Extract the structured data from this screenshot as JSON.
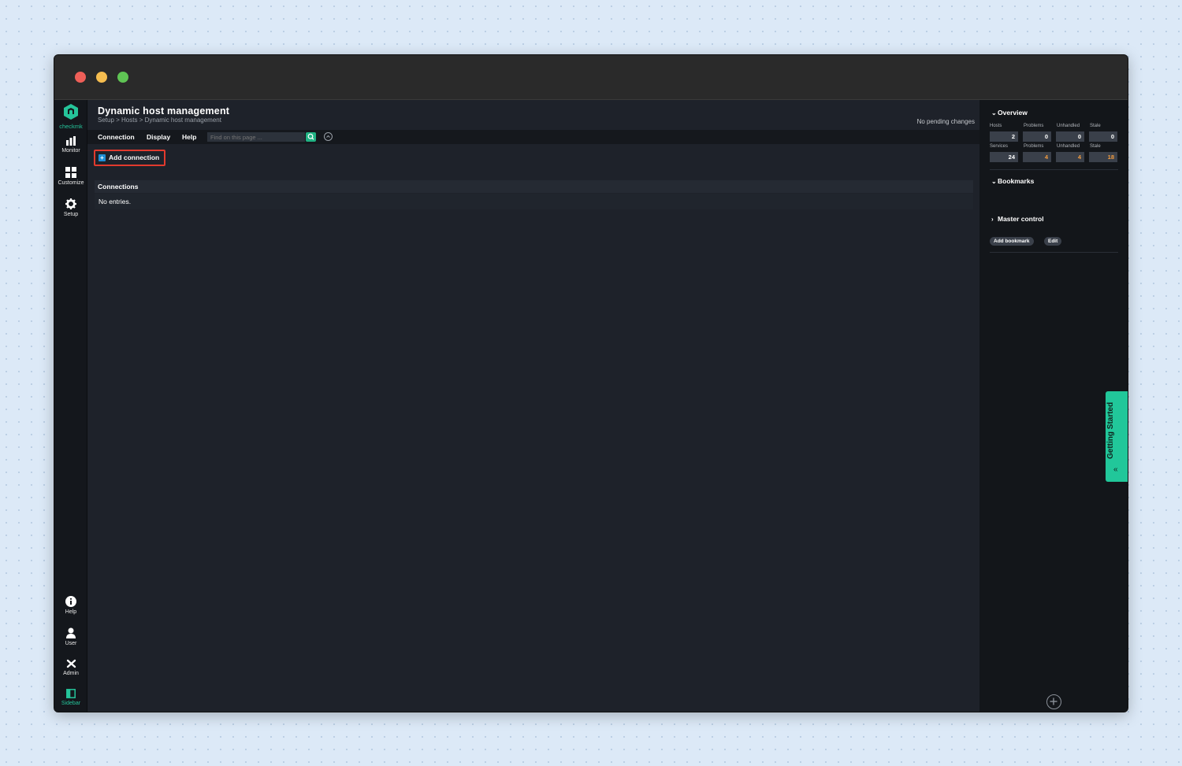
{
  "app": {
    "logo_text": "checkmk"
  },
  "nav": {
    "items": [
      {
        "label": "Monitor",
        "icon": "bar-chart-icon"
      },
      {
        "label": "Customize",
        "icon": "grid-icon"
      },
      {
        "label": "Setup",
        "icon": "gear-icon"
      }
    ],
    "bottom": [
      {
        "label": "Help",
        "icon": "info-icon"
      },
      {
        "label": "User",
        "icon": "user-icon"
      },
      {
        "label": "Admin",
        "icon": "tools-icon"
      },
      {
        "label": "Sidebar",
        "icon": "sidebar-icon"
      }
    ]
  },
  "page": {
    "title": "Dynamic host management",
    "breadcrumb": "Setup > Hosts > Dynamic host management",
    "pending": "No pending changes"
  },
  "menubar": {
    "items": [
      "Connection",
      "Display",
      "Help"
    ],
    "search_placeholder": "Find on this page ..."
  },
  "actions": {
    "add_connection": "Add connection"
  },
  "table": {
    "title": "Connections",
    "empty": "No entries."
  },
  "sidebar": {
    "overview": {
      "title": "Overview",
      "host_labels": [
        "Hosts",
        "Problems",
        "Unhandled",
        "Stale"
      ],
      "host_values": [
        "2",
        "0",
        "0",
        "0"
      ],
      "service_labels": [
        "Services",
        "Problems",
        "Unhandled",
        "Stale"
      ],
      "service_values": [
        "24",
        "4",
        "4",
        "18"
      ]
    },
    "bookmarks": {
      "title": "Bookmarks",
      "add_label": "Add bookmark",
      "edit_label": "Edit"
    },
    "master_control": {
      "title": "Master control"
    },
    "getting_started": "Getting Started",
    "colors": {
      "accent": "#21c79a",
      "warn": "#f39c3f",
      "highlight": "#e23a2e"
    }
  }
}
